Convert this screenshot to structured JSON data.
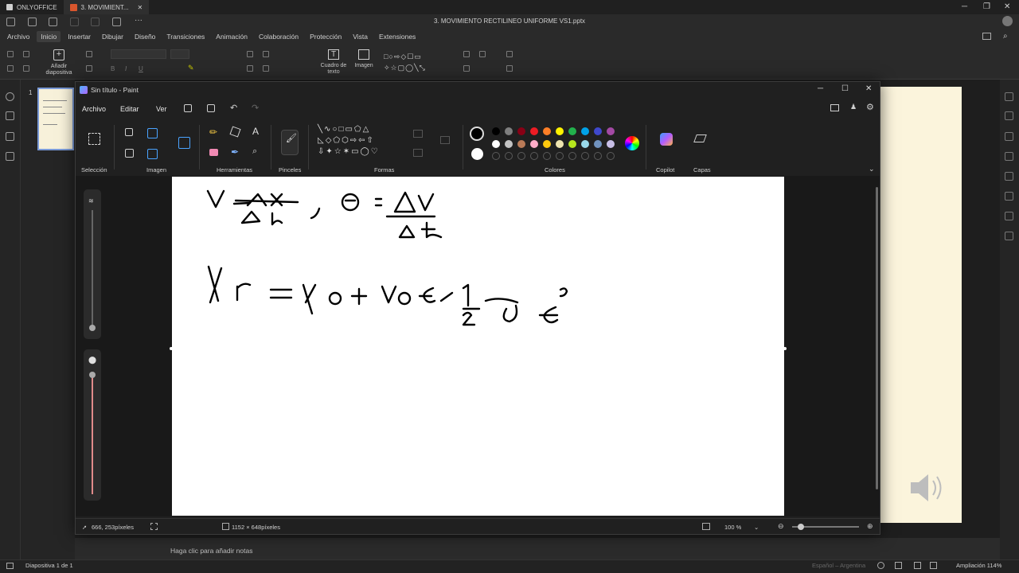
{
  "onlyoffice": {
    "brand": "ONLYOFFICE",
    "tab_title": "3. MOVIMIENT...",
    "doc_title": "3. MOVIMIENTO RECTILINEO UNIFORME VS1.pptx",
    "menu": [
      "Archivo",
      "Inicio",
      "Insertar",
      "Dibujar",
      "Diseño",
      "Transiciones",
      "Animación",
      "Colaboración",
      "Protección",
      "Vista",
      "Extensiones"
    ],
    "active_menu": "Inicio",
    "toolbar": {
      "add_slide": "Añadir diapositiva",
      "text_box": "Cuadro de texto",
      "image": "Imagen"
    },
    "slide_number": "1",
    "notes_placeholder": "Haga clic para añadir notas",
    "status": {
      "slide_counter": "Diapositiva 1 de 1",
      "language": "Español – Argentina",
      "zoom": "Ampliación 114%"
    }
  },
  "paint": {
    "title": "Sin título - Paint",
    "menu": {
      "file": "Archivo",
      "edit": "Editar",
      "view": "Ver"
    },
    "groups": {
      "selection": "Selección",
      "image": "Imagen",
      "tools": "Herramientas",
      "brushes": "Pinceles",
      "shapes": "Formas",
      "colors": "Colores",
      "copilot": "Copilot",
      "layers": "Capas"
    },
    "palette_row1": [
      "#000000",
      "#7f7f7f",
      "#880015",
      "#ed1c24",
      "#ff7f27",
      "#fff200",
      "#22b14c",
      "#00a2e8",
      "#3f48cc",
      "#a349a4"
    ],
    "palette_row2": [
      "#ffffff",
      "#c3c3c3",
      "#b97a57",
      "#ffaec9",
      "#ffc90e",
      "#efe4b0",
      "#b5e61d",
      "#99d9ea",
      "#7092be",
      "#c8bfe7"
    ],
    "status": {
      "cursor_pos": "666, 253píxeles",
      "canvas_size": "1152 × 648píxeles",
      "zoom": "100 %"
    }
  }
}
